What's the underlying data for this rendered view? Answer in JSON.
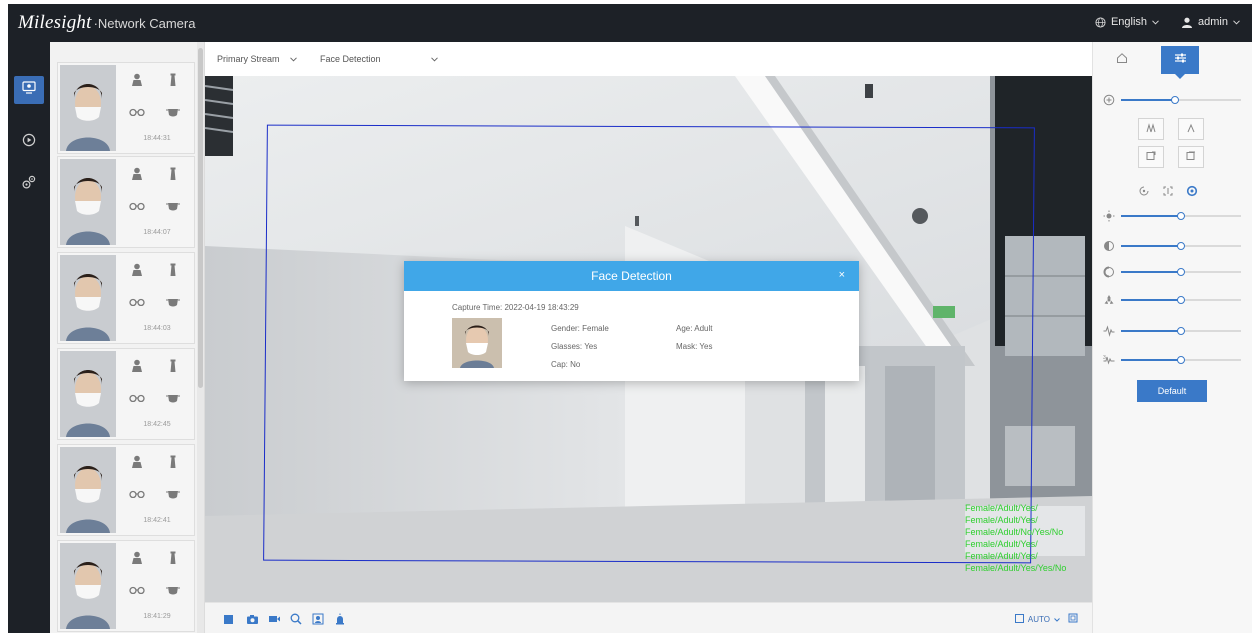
{
  "header": {
    "brand_logo": "Milesight",
    "brand_product": "·Network Camera",
    "language": "English",
    "user": "admin"
  },
  "nav": {
    "items": [
      {
        "icon": "live-view-icon",
        "active": true
      },
      {
        "icon": "playback-icon",
        "active": false
      },
      {
        "icon": "settings-icon",
        "active": false
      }
    ]
  },
  "captures": [
    {
      "time": "18:44:31",
      "hat": true,
      "glasses": true,
      "mask": true
    },
    {
      "time": "18:44:07",
      "hat": true,
      "glasses": true,
      "mask": true
    },
    {
      "time": "18:44:03",
      "hat": true,
      "glasses": true,
      "mask": true
    },
    {
      "time": "18:42:45",
      "hat": true,
      "glasses": true,
      "mask": true
    },
    {
      "time": "18:42:41",
      "hat": true,
      "glasses": true,
      "mask": true
    },
    {
      "time": "18:41:29",
      "hat": true,
      "glasses": true,
      "mask": true
    }
  ],
  "toolbar": {
    "stream": "Primary Stream",
    "mode": "Face Detection"
  },
  "dialog": {
    "title": "Face Detection",
    "close": "×",
    "capture_time": "Capture Time: 2022-04-19 18:43:29",
    "gender": "Gender: Female",
    "age": "Age: Adult",
    "glasses": "Glasses: Yes",
    "mask": "Mask: Yes",
    "cap": "Cap: No"
  },
  "osd_lines": [
    "Female/Adult/Yes/",
    "Female/Adult/Yes/",
    "Female/Adult/No/Yes/No",
    "Female/Adult/Yes/",
    "Female/Adult/Yes/",
    "Female/Adult/Yes/Yes/No"
  ],
  "video_bottom": {
    "auto_label": "AUTO"
  },
  "right_panel": {
    "tabs": [
      {
        "icon": "home-icon",
        "active": false
      },
      {
        "icon": "adjust-icon",
        "active": true
      }
    ],
    "zoom_level": 0.45,
    "sliders": [
      {
        "icon": "brightness-icon",
        "value": 0.5
      },
      {
        "icon": "contrast-icon",
        "value": 0.5
      },
      {
        "icon": "saturation-icon",
        "value": 0.5
      },
      {
        "icon": "sharpness-icon",
        "value": 0.5
      },
      {
        "icon": "noise-icon",
        "value": 0.5
      },
      {
        "icon": "hue-icon",
        "value": 0.5
      }
    ],
    "default_label": "Default"
  },
  "colors": {
    "topbar": "#1d2127",
    "accent": "#3a79c8",
    "dialog_header": "#40a7e8",
    "detect_box": "#1a2dc8",
    "osd": "#2fcf2f"
  }
}
